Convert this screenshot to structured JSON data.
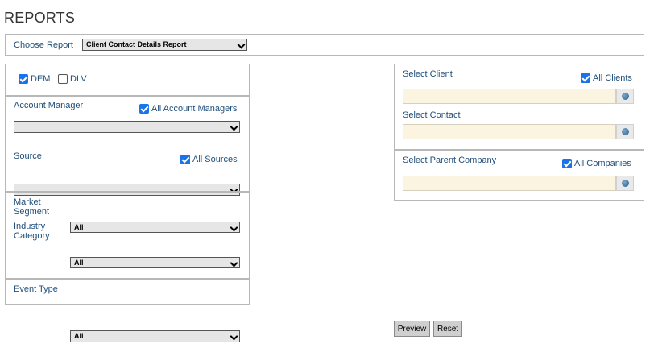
{
  "page": {
    "title": "REPORTS"
  },
  "choose_report": {
    "label": "Choose Report",
    "selected": "Client Contact Details Report"
  },
  "filters": {
    "dem": {
      "label": "DEM",
      "checked": true
    },
    "dlv": {
      "label": "DLV",
      "checked": false
    },
    "account_manager": {
      "label": "Account Manager",
      "all_label": "All Account Managers",
      "all_checked": true,
      "selected": ""
    },
    "source": {
      "label": "Source",
      "all_label": "All Sources",
      "all_checked": true,
      "selected": ""
    },
    "market_segment": {
      "label_line1": "Market",
      "label_line2": "Segment",
      "selected": "All"
    },
    "industry_category": {
      "label_line1": "Industry",
      "label_line2": "Category",
      "selected": "All"
    },
    "event_type": {
      "label": "Event Type",
      "selected": "All"
    }
  },
  "client_panel": {
    "client": {
      "label": "Select Client",
      "all_label": "All Clients",
      "all_checked": true,
      "value": ""
    },
    "contact": {
      "label": "Select Contact",
      "value": ""
    },
    "parent_company": {
      "label": "Select Parent Company",
      "all_label": "All Companies",
      "all_checked": true,
      "value": ""
    }
  },
  "actions": {
    "preview_label": "Preview",
    "reset_label": "Reset"
  },
  "icons": {
    "lookup": "globe-icon",
    "dropdown": "chevron-down-icon",
    "checkbox": "checkbox-icon"
  },
  "colors": {
    "label_text": "#1f4e79",
    "checkbox": "#1a73e8",
    "input_bg": "#fbf4e1",
    "border": "#b8b8b8"
  }
}
